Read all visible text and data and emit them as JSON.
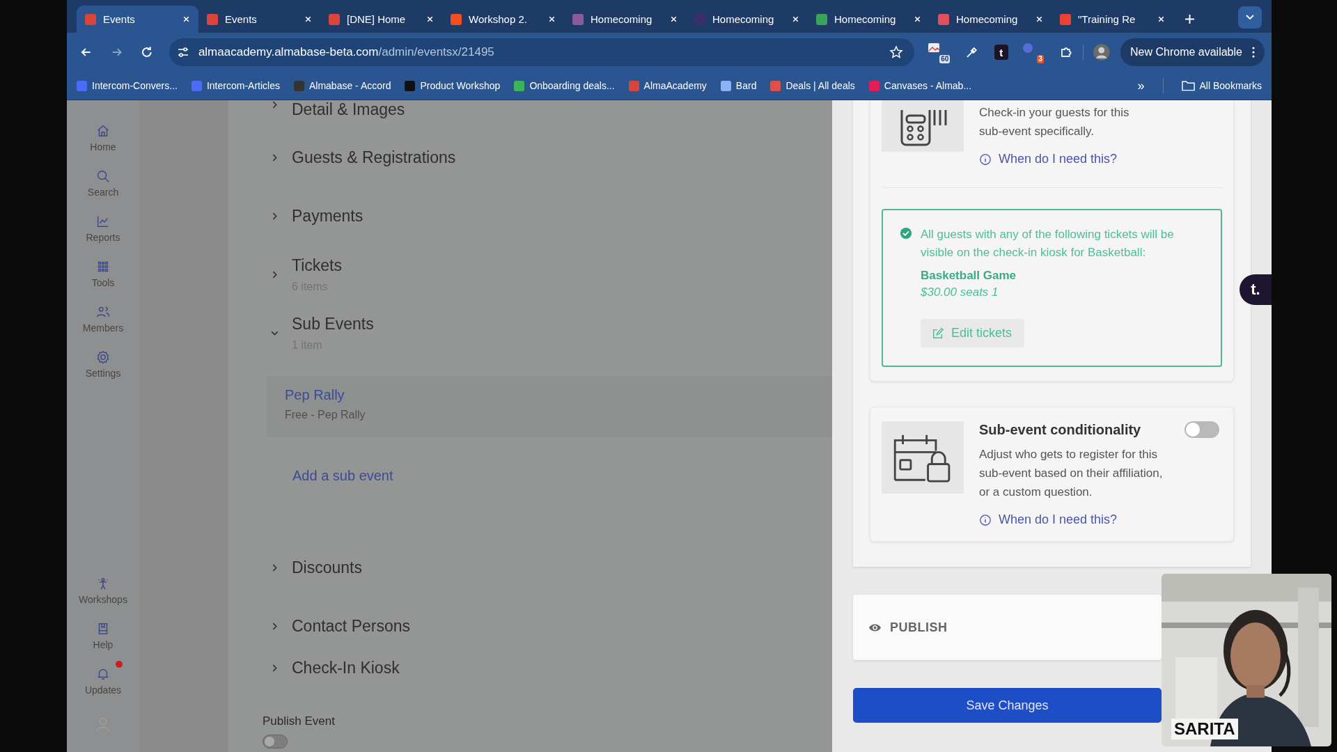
{
  "tabs": [
    {
      "title": "Events",
      "selected": true,
      "color": "#d9453a"
    },
    {
      "title": "Events",
      "selected": false,
      "color": "#d9453a"
    },
    {
      "title": "[DNE] Home",
      "selected": false,
      "color": "#d9453a"
    },
    {
      "title": "Workshop 2.",
      "selected": false,
      "color": "#f24e1e"
    },
    {
      "title": "Homecoming",
      "selected": false,
      "color": "#8a5a9a"
    },
    {
      "title": "Homecoming",
      "selected": false,
      "color": "#3a2f6b"
    },
    {
      "title": "Homecoming",
      "selected": false,
      "color": "#3aa35a"
    },
    {
      "title": "Homecoming",
      "selected": false,
      "color": "#e0505a"
    },
    {
      "title": "\"Training Re",
      "selected": false,
      "color": "#ea4335"
    }
  ],
  "url": {
    "host": "almaacademy.almabase-beta.com",
    "path": "/admin/eventsx/21495"
  },
  "toolbar": {
    "image_badge": "60",
    "ext_letter": "t",
    "ext_badge": "3",
    "update_label": "New Chrome available"
  },
  "bookmarks": [
    {
      "label": "Intercom-Convers...",
      "color": "#4a6cf7"
    },
    {
      "label": "Intercom-Articles",
      "color": "#4a6cf7"
    },
    {
      "label": "Almabase - Accord",
      "color": "#333333"
    },
    {
      "label": "Product Workshop",
      "color": "#111111"
    },
    {
      "label": "Onboarding deals...",
      "color": "#3cb55a"
    },
    {
      "label": "AlmaAcademy",
      "color": "#d9453a"
    },
    {
      "label": "Bard",
      "color": "#8ab4f8"
    },
    {
      "label": "Deals | All deals",
      "color": "#e0504a"
    },
    {
      "label": "Canvases - Almab...",
      "color": "#e01e5a"
    }
  ],
  "bookmarks_more": "»",
  "all_bookmarks": "All Bookmarks",
  "sidebar": {
    "top": [
      {
        "label": "Home"
      },
      {
        "label": "Search"
      },
      {
        "label": "Reports"
      },
      {
        "label": "Tools"
      },
      {
        "label": "Members"
      },
      {
        "label": "Settings"
      }
    ],
    "bottom": [
      {
        "label": "Workshops",
        "notification": false
      },
      {
        "label": "Help",
        "notification": false
      },
      {
        "label": "Updates",
        "notification": true
      }
    ]
  },
  "sections": [
    {
      "title": "Detail & Images",
      "expanded": false
    },
    {
      "title": "Guests & Registrations",
      "expanded": false
    },
    {
      "title": "Payments",
      "expanded": false
    },
    {
      "title": "Tickets",
      "subtitle": "6 items",
      "expanded": false
    },
    {
      "title": "Sub Events",
      "subtitle": "1 item",
      "expanded": true,
      "children": [
        {
          "title": "Pep Rally",
          "subtitle": "Free - Pep Rally"
        }
      ],
      "add_link": "Add a sub event"
    },
    {
      "title": "Discounts",
      "expanded": false
    },
    {
      "title": "Contact Persons",
      "expanded": false
    },
    {
      "title": "Check-In Kiosk",
      "expanded": false
    }
  ],
  "publish_event": {
    "label": "Publish Event",
    "on": false
  },
  "drawer": {
    "kiosk": {
      "description": "Check-in your guests for this sub-event specifically.",
      "help_link": "When do I need this?",
      "notice": {
        "text": "All guests with any of the following tickets will be visible on the check-in kiosk for Basketball:",
        "tickets": [
          {
            "name": "Basketball Game",
            "detail": "$30.00 seats 1"
          }
        ],
        "button": "Edit tickets"
      }
    },
    "conditionality": {
      "title": "Sub-event conditionality",
      "on": false,
      "description": "Adjust who gets to register for this sub-event based on their affiliation, or a custom question.",
      "help_link": "When do I need this?"
    },
    "publish": {
      "label": "PUBLISH"
    },
    "save_button": "Save Changes"
  },
  "float_button": "t.",
  "webcam": {
    "kind": "picture",
    "name": "SARITA"
  }
}
